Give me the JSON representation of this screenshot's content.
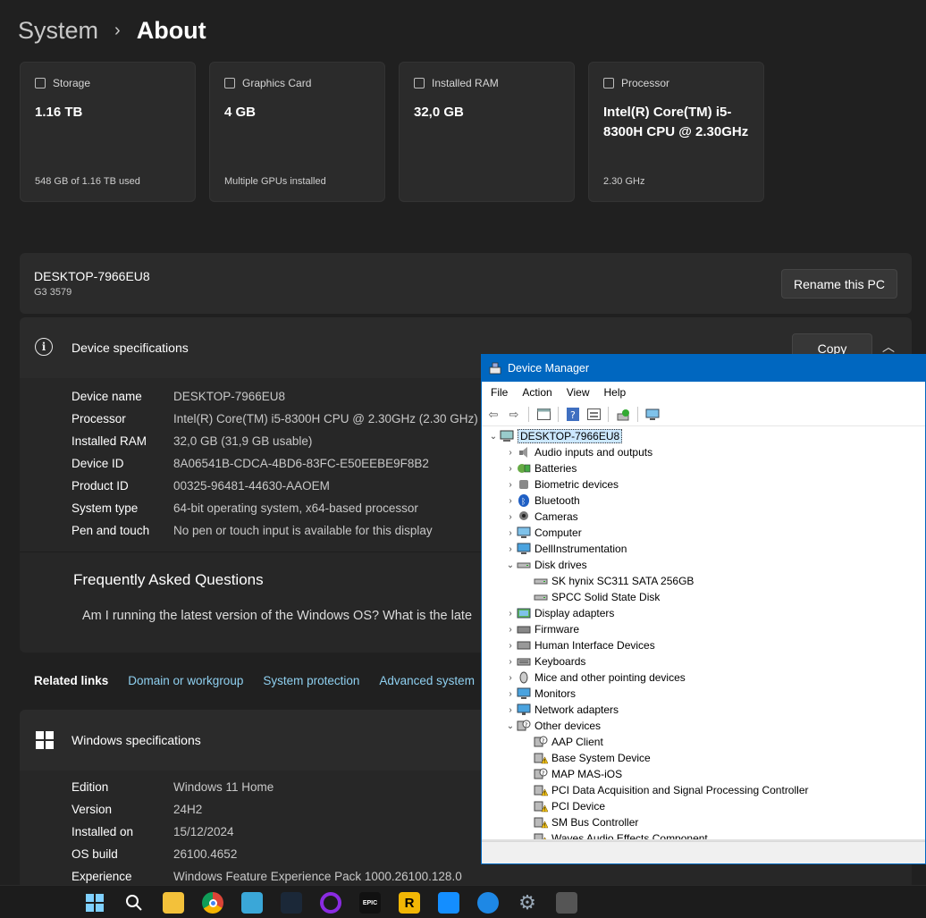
{
  "breadcrumb": {
    "parent": "System",
    "separator": "›",
    "current": "About"
  },
  "cards": [
    {
      "icon": "storage-icon",
      "label": "Storage",
      "value": "1.16 TB",
      "sub": "548 GB of 1.16 TB used"
    },
    {
      "icon": "graphics-card-icon",
      "label": "Graphics Card",
      "value": "4 GB",
      "sub": "Multiple GPUs installed"
    },
    {
      "icon": "ram-icon",
      "label": "Installed RAM",
      "value": "32,0 GB",
      "sub": ""
    },
    {
      "icon": "processor-icon",
      "label": "Processor",
      "value": "Intel(R) Core(TM) i5-8300H CPU @ 2.30GHz",
      "sub": "2.30 GHz"
    }
  ],
  "pc": {
    "name": "DESKTOP-7966EU8",
    "model": "G3 3579",
    "rename_label": "Rename this PC"
  },
  "device_specs": {
    "title": "Device specifications",
    "copy_label": "Copy",
    "rows": [
      {
        "label": "Device name",
        "value": "DESKTOP-7966EU8"
      },
      {
        "label": "Processor",
        "value": "Intel(R) Core(TM) i5-8300H CPU @ 2.30GHz (2.30 GHz)"
      },
      {
        "label": "Installed RAM",
        "value": "32,0 GB (31,9 GB usable)"
      },
      {
        "label": "Device ID",
        "value": "8A06541B-CDCA-4BD6-83FC-E50EEBE9F8B2"
      },
      {
        "label": "Product ID",
        "value": "00325-96481-44630-AAOEM"
      },
      {
        "label": "System type",
        "value": "64-bit operating system, x64-based processor"
      },
      {
        "label": "Pen and touch",
        "value": "No pen or touch input is available for this display"
      }
    ]
  },
  "faq": {
    "title": "Frequently Asked Questions",
    "question": "Am I running the latest version of the Windows OS? What is the late"
  },
  "related": {
    "label": "Related links",
    "links": [
      "Domain or workgroup",
      "System protection",
      "Advanced system"
    ]
  },
  "windows_specs": {
    "title": "Windows specifications",
    "rows": [
      {
        "label": "Edition",
        "value": "Windows 11 Home"
      },
      {
        "label": "Version",
        "value": "24H2"
      },
      {
        "label": "Installed on",
        "value": "15/12/2024"
      },
      {
        "label": "OS build",
        "value": "26100.4652"
      },
      {
        "label": "Experience",
        "value": "Windows Feature Experience Pack 1000.26100.128.0"
      }
    ]
  },
  "device_manager": {
    "title": "Device Manager",
    "menu": [
      "File",
      "Action",
      "View",
      "Help"
    ],
    "root": "DESKTOP-7966EU8",
    "tree": [
      {
        "label": "Audio inputs and outputs",
        "level": 1,
        "expander": "›",
        "icon": "speaker-icon"
      },
      {
        "label": "Batteries",
        "level": 1,
        "expander": "›",
        "icon": "battery-icon"
      },
      {
        "label": "Biometric devices",
        "level": 1,
        "expander": "›",
        "icon": "biometric-icon"
      },
      {
        "label": "Bluetooth",
        "level": 1,
        "expander": "›",
        "icon": "bluetooth-icon"
      },
      {
        "label": "Cameras",
        "level": 1,
        "expander": "›",
        "icon": "camera-icon"
      },
      {
        "label": "Computer",
        "level": 1,
        "expander": "›",
        "icon": "computer-icon"
      },
      {
        "label": "DellInstrumentation",
        "level": 1,
        "expander": "›",
        "icon": "monitor-icon"
      },
      {
        "label": "Disk drives",
        "level": 1,
        "expander": "⌄",
        "icon": "disk-icon"
      },
      {
        "label": "SK hynix SC311 SATA 256GB",
        "level": 2,
        "expander": "",
        "icon": "disk-icon"
      },
      {
        "label": "SPCC Solid State Disk",
        "level": 2,
        "expander": "",
        "icon": "disk-icon"
      },
      {
        "label": "Display adapters",
        "level": 1,
        "expander": "›",
        "icon": "display-adapter-icon"
      },
      {
        "label": "Firmware",
        "level": 1,
        "expander": "›",
        "icon": "firmware-icon"
      },
      {
        "label": "Human Interface Devices",
        "level": 1,
        "expander": "›",
        "icon": "hid-icon"
      },
      {
        "label": "Keyboards",
        "level": 1,
        "expander": "›",
        "icon": "keyboard-icon"
      },
      {
        "label": "Mice and other pointing devices",
        "level": 1,
        "expander": "›",
        "icon": "mouse-icon"
      },
      {
        "label": "Monitors",
        "level": 1,
        "expander": "›",
        "icon": "monitor-icon"
      },
      {
        "label": "Network adapters",
        "level": 1,
        "expander": "›",
        "icon": "network-icon"
      },
      {
        "label": "Other devices",
        "level": 1,
        "expander": "⌄",
        "icon": "unknown-device-icon"
      },
      {
        "label": "AAP Client",
        "level": 2,
        "expander": "",
        "icon": "unknown-device-icon"
      },
      {
        "label": "Base System Device",
        "level": 2,
        "expander": "",
        "icon": "warning-device-icon"
      },
      {
        "label": "MAP MAS-iOS",
        "level": 2,
        "expander": "",
        "icon": "unknown-device-icon"
      },
      {
        "label": "PCI Data Acquisition and Signal Processing Controller",
        "level": 2,
        "expander": "",
        "icon": "warning-device-icon"
      },
      {
        "label": "PCI Device",
        "level": 2,
        "expander": "",
        "icon": "warning-device-icon"
      },
      {
        "label": "SM Bus Controller",
        "level": 2,
        "expander": "",
        "icon": "warning-device-icon"
      },
      {
        "label": "Waves Audio Effects Component",
        "level": 2,
        "expander": "",
        "icon": "warning-device-icon"
      }
    ]
  },
  "taskbar": [
    {
      "name": "start-icon",
      "glyph": "",
      "bg": "#1a8fe3"
    },
    {
      "name": "search-icon",
      "glyph": "",
      "bg": "transparent"
    },
    {
      "name": "file-explorer-icon",
      "glyph": "",
      "bg": "#f3c13a"
    },
    {
      "name": "chrome-icon",
      "glyph": "",
      "bg": "#db4437"
    },
    {
      "name": "app-icon",
      "glyph": "",
      "bg": "#3aa7d8"
    },
    {
      "name": "steam-icon",
      "glyph": "",
      "bg": "#1b2838"
    },
    {
      "name": "circle-app-icon",
      "glyph": "",
      "bg": "#6a1bb0"
    },
    {
      "name": "epic-games-icon",
      "glyph": "EPIC",
      "bg": "#111111"
    },
    {
      "name": "rockstar-icon",
      "glyph": "R",
      "bg": "#f2b705"
    },
    {
      "name": "battlenet-icon",
      "glyph": "",
      "bg": "#148eff"
    },
    {
      "name": "edge-icon",
      "glyph": "",
      "bg": "#1e88e5"
    },
    {
      "name": "settings-icon",
      "glyph": "⚙",
      "bg": "transparent"
    },
    {
      "name": "device-manager-icon",
      "glyph": "",
      "bg": "#555555"
    }
  ]
}
